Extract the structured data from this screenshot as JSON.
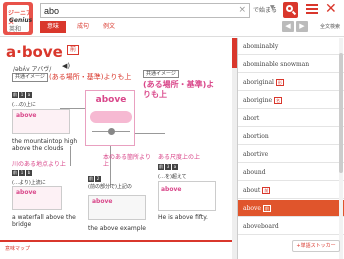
{
  "header": {
    "logo": {
      "line1": "ジーニアス",
      "line2": "Genius",
      "line3": "英和"
    },
    "search_value": "abo",
    "search_clear": "×",
    "mode_label": "で始まる",
    "mode_arrow": "▼",
    "tabs": [
      "意味",
      "成句",
      "例文"
    ],
    "nav_prev": "◀",
    "nav_next": "▶",
    "list_label": "全文検索"
  },
  "entry": {
    "headword": "a·bove",
    "badge": "前",
    "pronunciation": "/əbʌ́v アバヴ/",
    "speaker": "◀)",
    "image_tag": "共通イメージ",
    "image_caption": "(ある場所・基準)よりも上",
    "core_word": "above",
    "core_tag": "共通イメージ",
    "core_text": "(ある場所・基準)よりも上",
    "senses": [
      {
        "nums": [
          "前",
          "1",
          "a"
        ],
        "desc": "(…の)上に",
        "pic_word": "above",
        "example": "the mountaintop high above the clouds"
      },
      {
        "nums": [
          "前",
          "1",
          "b"
        ],
        "desc": "(…より)上流に",
        "pic_word": "above",
        "example": "a waterfall above the bridge"
      },
      {
        "nums": [
          "前",
          "2"
        ],
        "desc": "(前の部分で)上記の",
        "pic_word": "above",
        "example": "the above example"
      },
      {
        "nums": [
          "前",
          "3",
          "a"
        ],
        "desc": "(…を)超えて",
        "pic_word": "above",
        "example": "He is above fifty."
      }
    ],
    "side_notes": [
      "川のある地点より上",
      "本のある箇所より上",
      "ある尺度上の上"
    ],
    "footer_label": "意味マップ"
  },
  "wordlist": {
    "items": [
      {
        "text": "abominably",
        "badge": ""
      },
      {
        "text": "abominable snowman",
        "badge": ""
      },
      {
        "text": "aboriginal",
        "badge": "形"
      },
      {
        "text": "aborigine",
        "badge": "名"
      },
      {
        "text": "abort",
        "badge": ""
      },
      {
        "text": "abortion",
        "badge": ""
      },
      {
        "text": "abortive",
        "badge": ""
      },
      {
        "text": "abound",
        "badge": ""
      },
      {
        "text": "about",
        "badge": "前"
      },
      {
        "text": "above",
        "badge": "前",
        "selected": true
      },
      {
        "text": "aboveboard",
        "badge": ""
      }
    ],
    "stocker": "+単語ストッカー"
  },
  "colors": {
    "accent": "#d9372c",
    "pink": "#d9478a"
  }
}
